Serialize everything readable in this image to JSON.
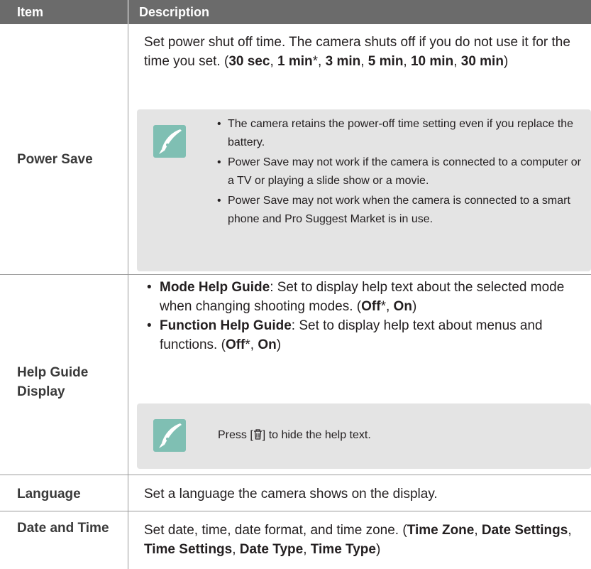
{
  "header": {
    "item": "Item",
    "description": "Description"
  },
  "rows": {
    "power_save": {
      "item": "Power Save",
      "desc_prefix": "Set power shut off time. The camera shuts off if you do not use it for the time you set. (",
      "opt1": "30 sec",
      "sep1": ", ",
      "opt2": "1 min",
      "star": "*",
      "sep2": ", ",
      "opt3": "3 min",
      "sep3": ", ",
      "opt4": "5 min",
      "sep4": ", ",
      "opt5": "10 min",
      "sep5": ", ",
      "opt6": "30 min",
      "desc_suffix": ")",
      "notes": [
        "The camera retains the power-off time setting even if you replace the battery.",
        "Power Save may not work if the camera is connected to a computer or a TV or playing a slide show or a movie.",
        "Power Save may not work when the camera is connected to a smart phone and Pro Suggest Market is in use."
      ]
    },
    "help_guide": {
      "item": "Help Guide Display",
      "b1_title": "Mode Help Guide",
      "b1_text": ": Set to display help text about the selected mode when changing shooting modes. (",
      "b1_off": "Off",
      "b1_star": "*",
      "b1_sep": ", ",
      "b1_on": "On",
      "b1_end": ")",
      "b2_title": "Function Help Guide",
      "b2_text": ": Set to display help text about menus and functions. (",
      "b2_off": "Off",
      "b2_star": "*",
      "b2_sep": ", ",
      "b2_on": "On",
      "b2_end": ")",
      "note_prefix": "Press [",
      "note_icon": "trash-icon",
      "note_suffix": "] to hide the help text."
    },
    "language": {
      "item": "Language",
      "desc": "Set a language the camera shows on the display."
    },
    "date_time": {
      "item": "Date and Time",
      "desc_prefix": "Set date, time, date format, and time zone. (",
      "o1": "Time Zone",
      "s1": ", ",
      "o2": "Date Settings",
      "s2": ", ",
      "o3": "Time Settings",
      "s3": ", ",
      "o4": "Date Type",
      "s4": ", ",
      "o5": "Time Type",
      "desc_suffix": ")"
    }
  },
  "colors": {
    "header_bg": "#6b6b6b",
    "note_bg": "#e4e4e4",
    "pen_icon_bg": "#7fbfb3"
  },
  "icons": {
    "note": "pen-note-icon"
  }
}
